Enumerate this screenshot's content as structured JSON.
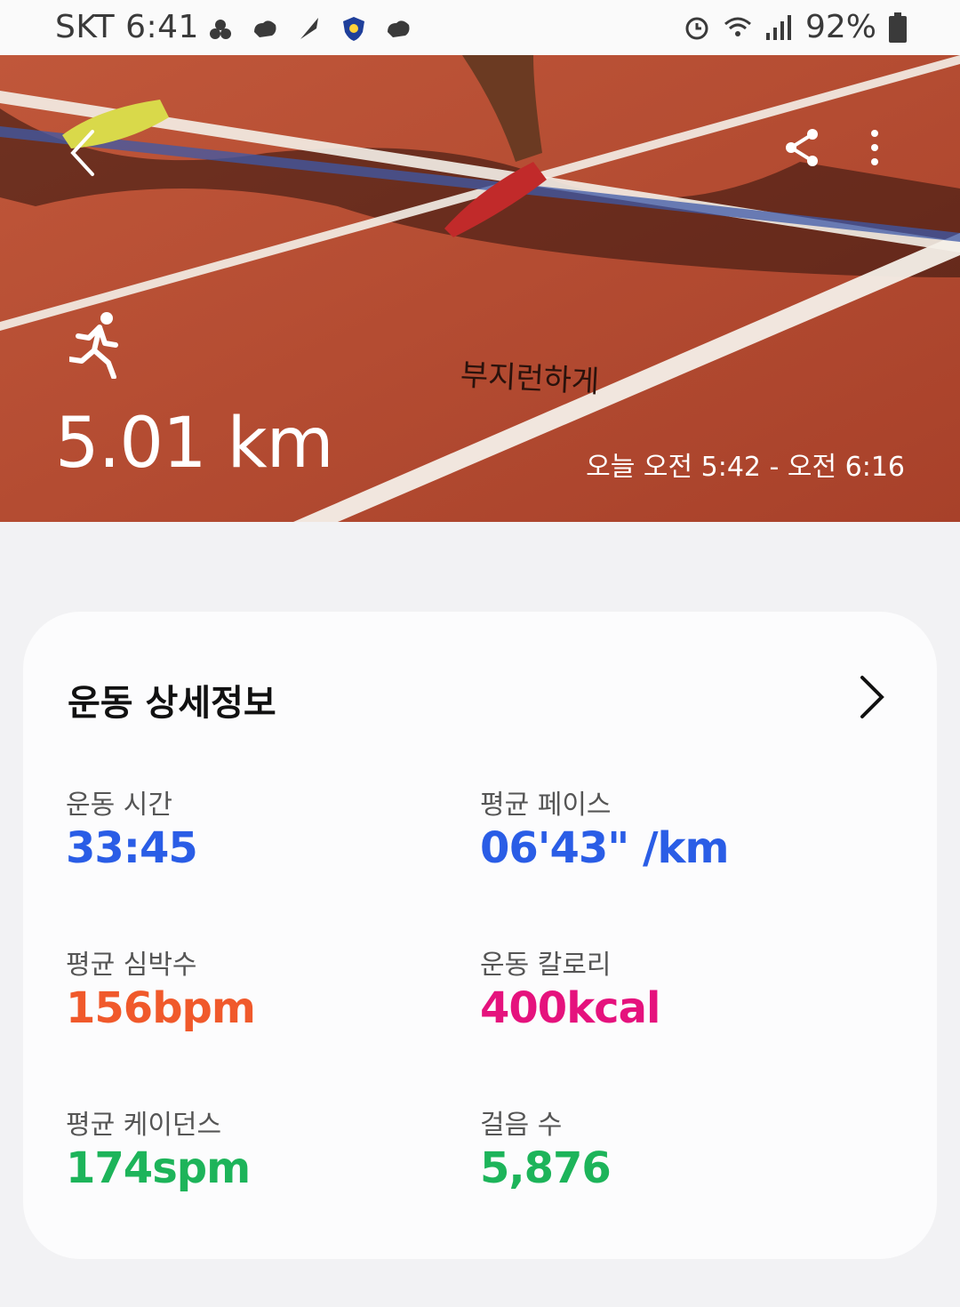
{
  "status_bar": {
    "carrier": "SKT",
    "time": "6:41",
    "battery": "92%",
    "left_icons": [
      "puzzle-icon",
      "cloud-icon",
      "feather-icon",
      "shield-app-icon",
      "cloud-icon"
    ],
    "right_icons": [
      "alarm-icon",
      "wifi-icon",
      "signal-icon",
      "battery-icon"
    ]
  },
  "hero": {
    "distance": "5.01 km",
    "time_range": "오늘 오전 5:42 - 오전 6:16",
    "motto": "부지런하게",
    "activity_icon": "running-icon",
    "colors": {
      "track": "#b5492f",
      "lines": "#f4efe8",
      "text": "#ffffff"
    }
  },
  "card": {
    "title": "운동 상세정보",
    "stats": [
      {
        "label": "운동 시간",
        "value": "33:45",
        "color": "#2a5de6"
      },
      {
        "label": "평균 페이스",
        "value": "06'43\" /km",
        "color": "#2a5de6"
      },
      {
        "label": "평균 심박수",
        "value": "156bpm",
        "color": "#f0592b"
      },
      {
        "label": "운동 칼로리",
        "value": "400kcal",
        "color": "#e5127d"
      },
      {
        "label": "평균 케이던스",
        "value": "174spm",
        "color": "#1db45a"
      },
      {
        "label": "걸음 수",
        "value": "5,876",
        "color": "#1db45a"
      }
    ]
  }
}
